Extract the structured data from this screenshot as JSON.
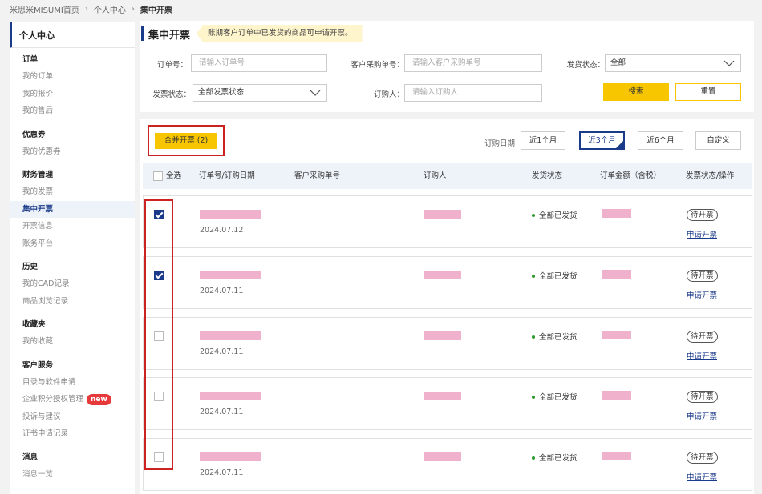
{
  "breadcrumb": [
    "米思米MISUMI首页",
    "个人中心",
    "集中开票"
  ],
  "sidebar": {
    "title": "个人中心",
    "sections": [
      {
        "title": "订单",
        "items": [
          "我的订单",
          "我的报价",
          "我的售后"
        ]
      },
      {
        "title": "优惠券",
        "items": [
          "我的优惠券"
        ]
      },
      {
        "title": "财务管理",
        "items": [
          "我的发票",
          "集中开票",
          "开票信息",
          "账务平台"
        ]
      },
      {
        "title": "历史",
        "items": [
          "我的CAD记录",
          "商品浏览记录"
        ]
      },
      {
        "title": "收藏夹",
        "items": [
          "我的收藏"
        ]
      },
      {
        "title": "客户服务",
        "items": [
          "目录与软件申请",
          "企业积分授权管理",
          "投诉与建议",
          "证书申请记录"
        ]
      },
      {
        "title": "消息",
        "items": [
          "消息一览"
        ]
      }
    ],
    "active_item": "集中开票",
    "new_badge": "new"
  },
  "header": {
    "title": "集中开票",
    "notice": "账期客户订单中已发货的商品可申请开票。"
  },
  "filters": {
    "order_no_label": "订单号：",
    "order_no_placeholder": "请输入订单号",
    "customer_po_label": "客户采购单号：",
    "customer_po_placeholder": "请输入客户采购单号",
    "ship_status_label": "发货状态：",
    "ship_status_value": "全部",
    "invoice_status_label": "发票状态：",
    "invoice_status_value": "全部发票状态",
    "buyer_label": "订购人：",
    "buyer_placeholder": "请输入订购人",
    "search_label": "搜索",
    "reset_label": "重置"
  },
  "toolbar": {
    "merge_label": "合并开票 (2)",
    "date_label": "订购日期",
    "ranges": [
      "近1个月",
      "近3个月",
      "近6个月",
      "自定义"
    ],
    "active_range": "近3个月"
  },
  "table": {
    "select_all": "全选",
    "columns": [
      "订单号/订购日期",
      "客户采购单号",
      "订购人",
      "发货状态",
      "订单金额（含税）",
      "发票状态/操作"
    ],
    "rows": [
      {
        "checked": true,
        "date": "2024.07.12",
        "ship_status": "全部已发货",
        "invoice_status": "待开票",
        "action": "申请开票"
      },
      {
        "checked": true,
        "date": "2024.07.11",
        "ship_status": "全部已发货",
        "invoice_status": "待开票",
        "action": "申请开票"
      },
      {
        "checked": false,
        "date": "2024.07.11",
        "ship_status": "全部已发货",
        "invoice_status": "待开票",
        "action": "申请开票"
      },
      {
        "checked": false,
        "date": "2024.07.11",
        "ship_status": "全部已发货",
        "invoice_status": "待开票",
        "action": "申请开票"
      },
      {
        "checked": false,
        "date": "2024.07.11",
        "ship_status": "全部已发货",
        "invoice_status": "待开票",
        "action": "申请开票"
      }
    ]
  },
  "colors": {
    "accent": "#1a3a8a",
    "button_yellow": "#f7c600",
    "highlight_red": "#cc2222",
    "redaction_pink": "#f0b1cc",
    "status_green": "#2e9a2e"
  }
}
